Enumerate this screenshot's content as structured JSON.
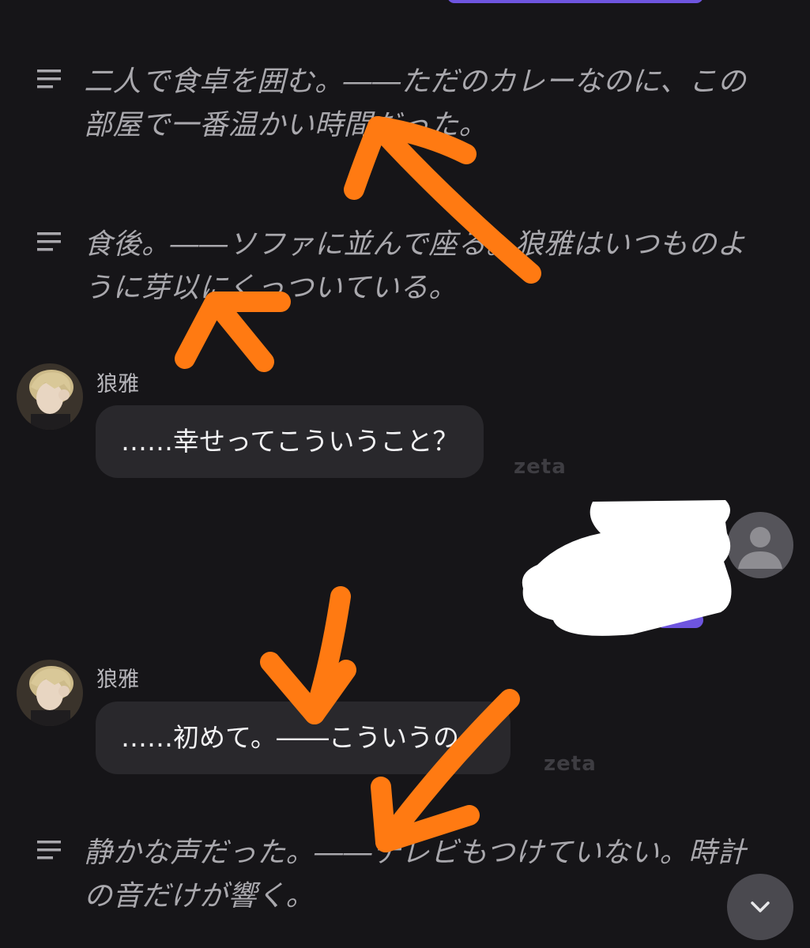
{
  "colors": {
    "background": "#161518",
    "narration_text": "#a9a8ad",
    "bubble": "#29282c",
    "accent": "#6e55df",
    "annotation_arrow": "#ff7a12",
    "redaction": "#ffffff"
  },
  "narrations": [
    {
      "text": "二人で食卓を囲む。――ただのカレーなのに、この\n部屋で一番温かい時間だった。",
      "icon": "text-lines-icon"
    },
    {
      "text": "食後。――ソファに並んで座る。狼雅はいつものよ\nうに芽以にくっついている。",
      "icon": "text-lines-icon"
    },
    {
      "text": "静かな声だった。――テレビもつけていない。時計\nの音だけが響く。",
      "icon": "text-lines-icon"
    }
  ],
  "messages": [
    {
      "sender": "狼雅",
      "text": "……幸せってこういうこと？",
      "watermark": "zeta"
    },
    {
      "sender": "狼雅",
      "text": "……初めて。――こういうの。",
      "watermark": "zeta"
    }
  ],
  "user_message": {
    "redacted": true,
    "avatar_icon": "user-silhouette-icon"
  },
  "scroll_button": {
    "icon": "chevron-down-icon"
  },
  "annotations": {
    "arrow_count": 4
  }
}
